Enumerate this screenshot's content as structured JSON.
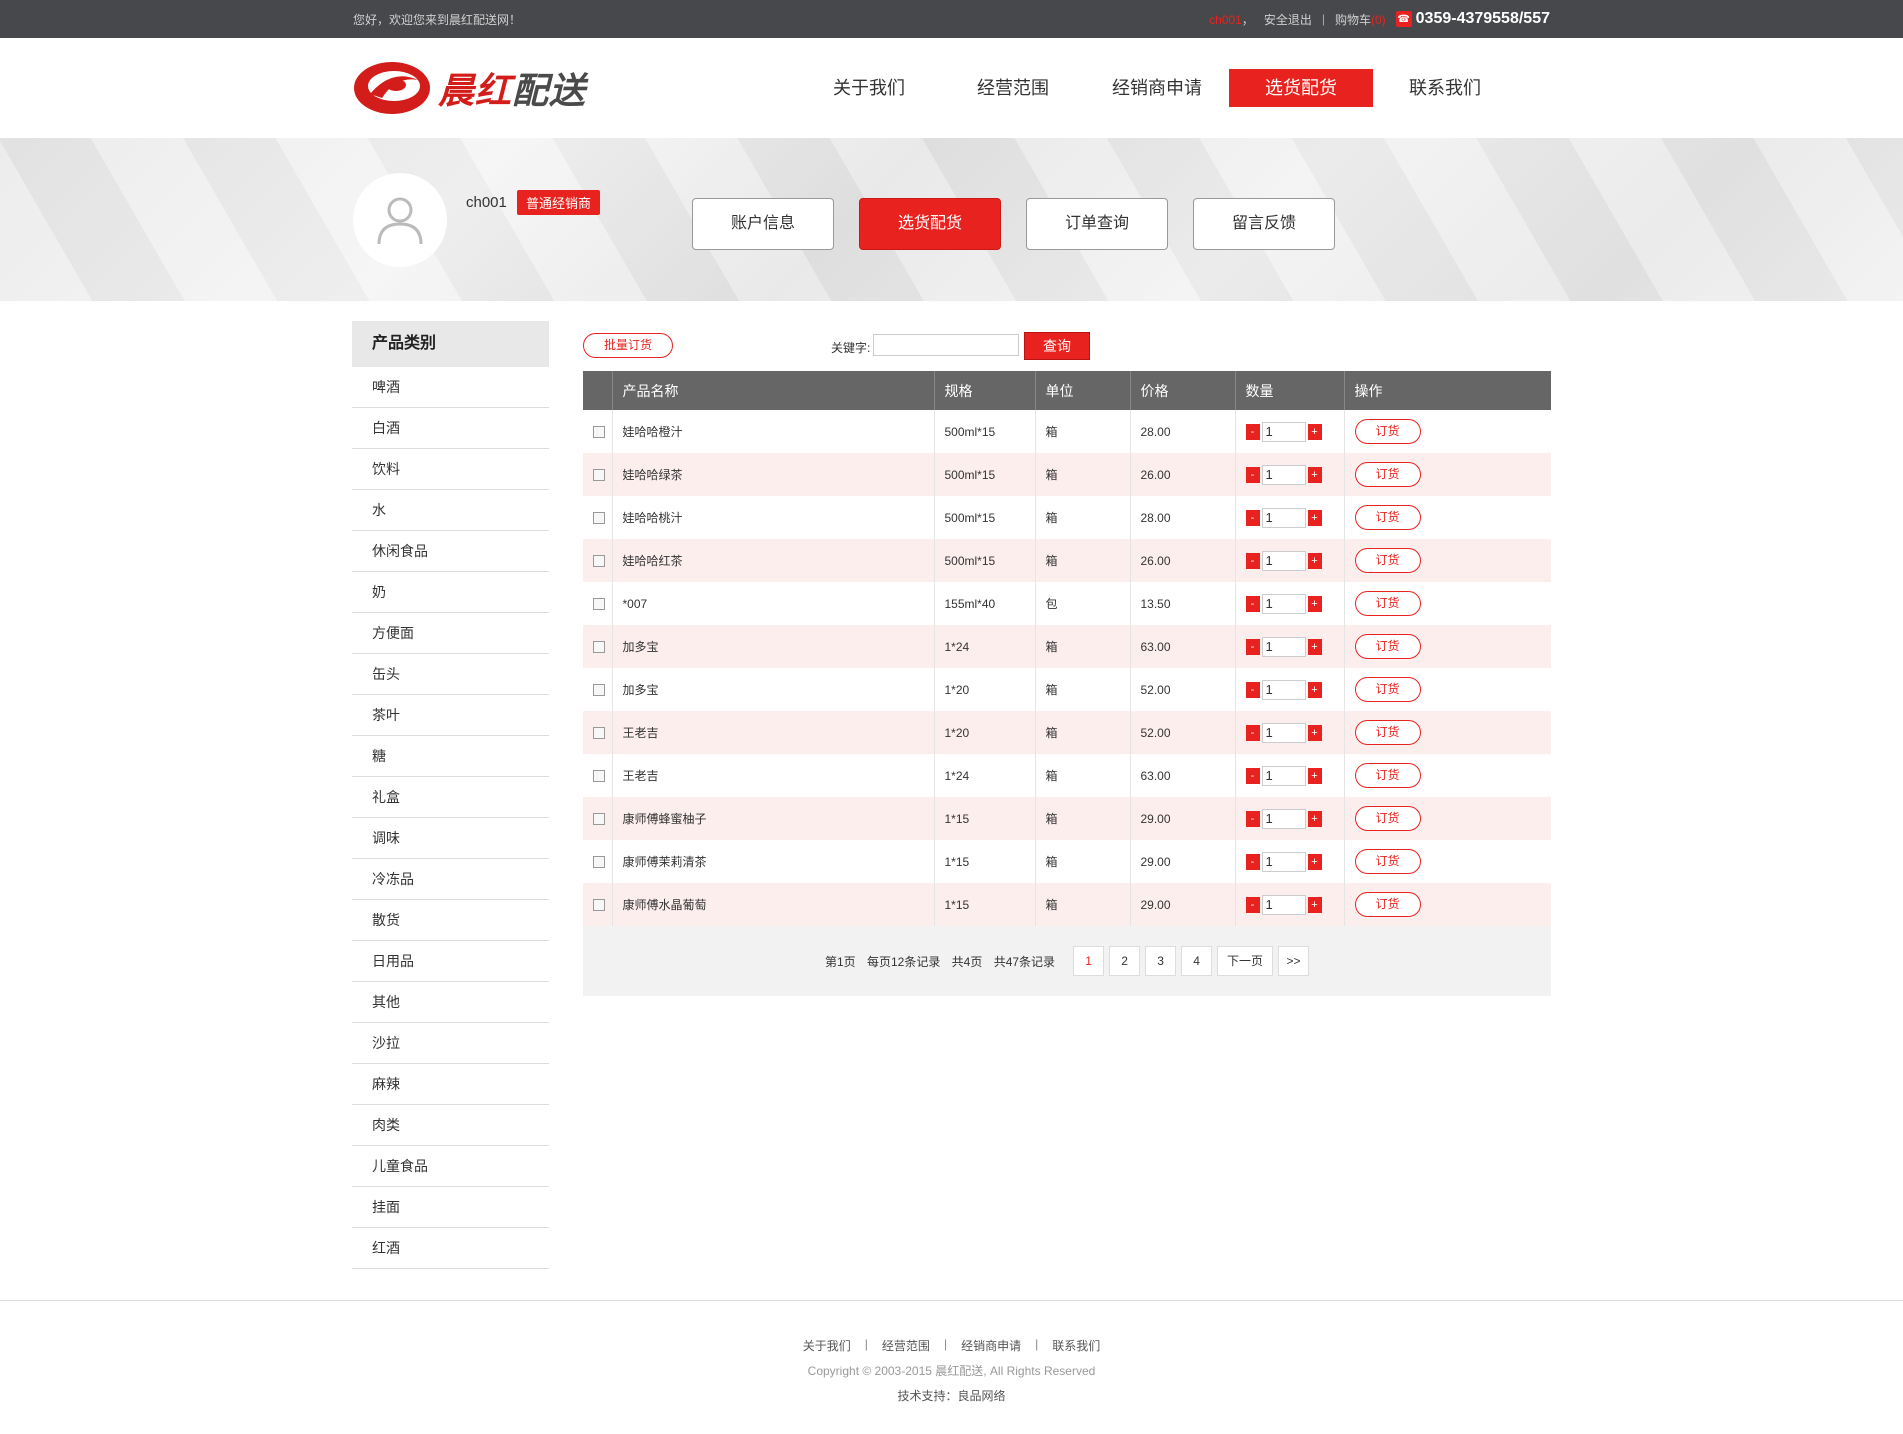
{
  "topbar": {
    "welcome": "您好，欢迎您来到晨红配送网！",
    "user": "ch001",
    "comma": "，",
    "logout": "安全退出",
    "sep": "|",
    "cart_label": "购物车",
    "cart_count": "(0)",
    "phone": "0359-4379558/557"
  },
  "header": {
    "logo_text_red": "晨红",
    "logo_text_gray": "配送",
    "nav": [
      {
        "label": "关于我们"
      },
      {
        "label": "经营范围"
      },
      {
        "label": "经销商申请"
      },
      {
        "label": "选货配货"
      },
      {
        "label": "联系我们"
      }
    ]
  },
  "banner": {
    "username": "ch001",
    "level": "普通经销商",
    "tabs": [
      {
        "label": "账户信息"
      },
      {
        "label": "选货配货"
      },
      {
        "label": "订单查询"
      },
      {
        "label": "留言反馈"
      }
    ]
  },
  "sidebar": {
    "title": "产品类别",
    "items": [
      "啤酒",
      "白酒",
      "饮料",
      "水",
      "休闲食品",
      "奶",
      "方便面",
      "缶头",
      "茶叶",
      "糖",
      "礼盒",
      "调味",
      "冷冻品",
      "散货",
      "日用品",
      "其他",
      "沙拉",
      "麻辣",
      "肉类",
      "儿童食品",
      "挂面",
      "红酒"
    ]
  },
  "toolbar": {
    "batch_label": "批量订货",
    "keyword_label": "关键字:",
    "keyword_value": "",
    "search_label": "查询"
  },
  "table": {
    "headers": [
      "",
      "产品名称",
      "规格",
      "单位",
      "价格",
      "数量",
      "操作"
    ],
    "minus": "-",
    "plus": "+",
    "order_label": "订货",
    "rows": [
      {
        "name": "娃哈哈橙汁",
        "spec": "500ml*15",
        "unit": "箱",
        "price": "28.00",
        "qty": "1"
      },
      {
        "name": "娃哈哈绿茶",
        "spec": "500ml*15",
        "unit": "箱",
        "price": "26.00",
        "qty": "1"
      },
      {
        "name": "娃哈哈桃汁",
        "spec": "500ml*15",
        "unit": "箱",
        "price": "28.00",
        "qty": "1"
      },
      {
        "name": "娃哈哈红茶",
        "spec": "500ml*15",
        "unit": "箱",
        "price": "26.00",
        "qty": "1"
      },
      {
        "name": "*007",
        "spec": "155ml*40",
        "unit": "包",
        "price": "13.50",
        "qty": "1"
      },
      {
        "name": "加多宝",
        "spec": "1*24",
        "unit": "箱",
        "price": "63.00",
        "qty": "1"
      },
      {
        "name": "加多宝",
        "spec": "1*20",
        "unit": "箱",
        "price": "52.00",
        "qty": "1"
      },
      {
        "name": "王老吉",
        "spec": "1*20",
        "unit": "箱",
        "price": "52.00",
        "qty": "1"
      },
      {
        "name": "王老吉",
        "spec": "1*24",
        "unit": "箱",
        "price": "63.00",
        "qty": "1"
      },
      {
        "name": "康师傅蜂蜜柚子",
        "spec": "1*15",
        "unit": "箱",
        "price": "29.00",
        "qty": "1"
      },
      {
        "name": "康师傅茉莉清茶",
        "spec": "1*15",
        "unit": "箱",
        "price": "29.00",
        "qty": "1"
      },
      {
        "name": "康师傅水晶葡萄",
        "spec": "1*15",
        "unit": "箱",
        "price": "29.00",
        "qty": "1"
      }
    ]
  },
  "pager": {
    "current_page": "第1页",
    "per_page": "每页12条记录",
    "total_pages": "共4页",
    "total_records": "共47条记录",
    "pages": [
      "1",
      "2",
      "3",
      "4"
    ],
    "next": "下一页",
    "last": ">>"
  },
  "footer": {
    "links": [
      "关于我们",
      "经营范围",
      "经销商申请",
      "联系我们"
    ],
    "sep": "|",
    "copyright": "Copyright © 2003-2015 晨红配送, All Rights Reserved",
    "support": "技术支持：良品网络"
  },
  "colors": {
    "accent": "#e8231f",
    "topbar": "#46484b",
    "table_header": "#666666",
    "row_alt": "#fdeeee"
  }
}
